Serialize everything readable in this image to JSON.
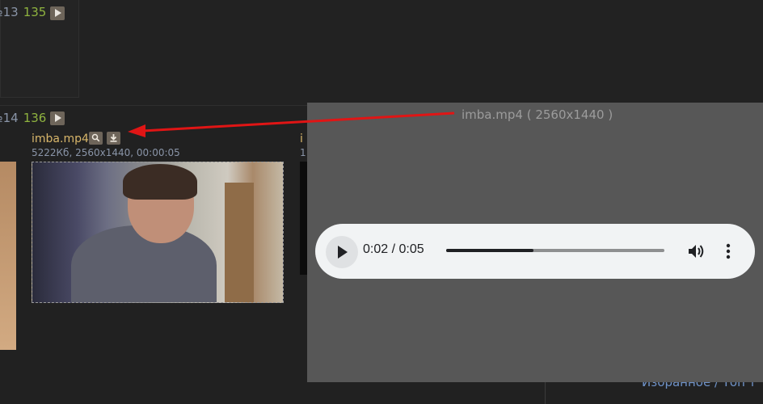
{
  "posts": [
    {
      "id_fragment": "13",
      "number": "135"
    },
    {
      "id_fragment": "14",
      "number": "136"
    }
  ],
  "attachment": {
    "name": "imba.mp4",
    "meta": "5222Кб, 2560x1440, 00:00:05",
    "search_icon": "search-icon",
    "download_icon": "download-icon"
  },
  "neighbor_attachment": {
    "name_fragment": "i",
    "meta_fragment": "1"
  },
  "overlay": {
    "title": "imba.mp4 ( 2560x1440 )"
  },
  "player": {
    "time": "0:02 / 0:05",
    "progress": 0.4,
    "volume_icon": "volume-icon",
    "more_icon": "more-vert-icon"
  },
  "footer": {
    "links_text": "Избранное / Топ т"
  },
  "colors": {
    "accent_green": "#8fb33f",
    "link_blue": "#6f93c9",
    "filename_gold": "#d8b66a",
    "annotation_red": "#e01515"
  }
}
